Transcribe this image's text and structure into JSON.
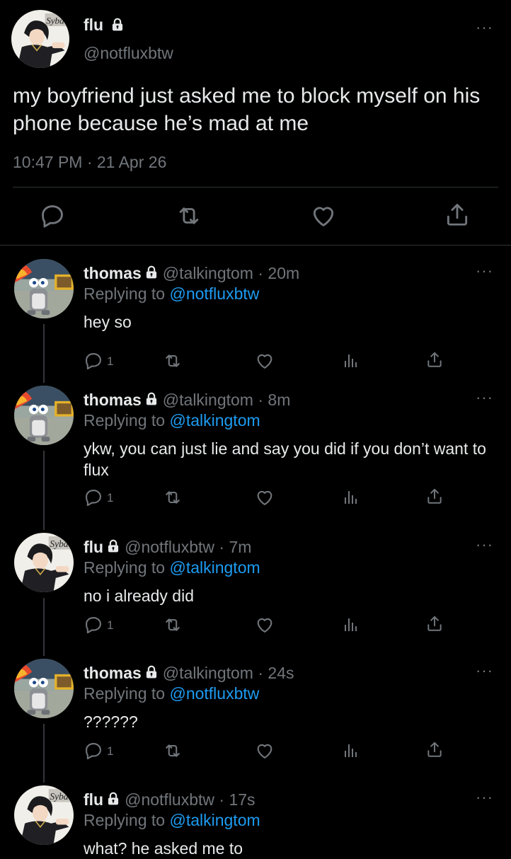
{
  "main_tweet": {
    "name": "flu",
    "handle": "@notfluxbtw",
    "text": "my boyfriend just asked me to block myself on his phone because he’s mad at me",
    "time": "10:47 PM · 21 Apr 26"
  },
  "replies": [
    {
      "name": "thomas",
      "handle": "@talkingtom",
      "age": "· 20m",
      "replying_prefix": "Replying to ",
      "replying_to": "@notfluxbtw",
      "text": "hey so",
      "reply_count": "1",
      "avatar": "tom"
    },
    {
      "name": "thomas",
      "handle": "@talkingtom",
      "age": "· 8m",
      "replying_prefix": "Replying to ",
      "replying_to": "@talkingtom",
      "text": "ykw, you can just lie and say you did if you don’t want to flux",
      "reply_count": "1",
      "avatar": "tom"
    },
    {
      "name": "flu",
      "handle": "@notfluxbtw",
      "age": "· 7m",
      "replying_prefix": "Replying to ",
      "replying_to": "@talkingtom",
      "text": "no i already did",
      "reply_count": "1",
      "avatar": "flu"
    },
    {
      "name": "thomas",
      "handle": "@talkingtom",
      "age": "· 24s",
      "replying_prefix": "Replying to ",
      "replying_to": "@notfluxbtw",
      "text": "??????",
      "reply_count": "1",
      "avatar": "tom"
    },
    {
      "name": "flu",
      "handle": "@notfluxbtw",
      "age": "· 17s",
      "replying_prefix": "Replying to ",
      "replying_to": "@talkingtom",
      "text": "what? he asked me to",
      "reply_count": "",
      "avatar": "flu"
    }
  ],
  "icons": {
    "more": "more-icon",
    "reply": "reply-icon",
    "retweet": "retweet-icon",
    "like": "heart-icon",
    "views": "analytics-icon",
    "share": "share-icon",
    "lock": "lock-icon"
  },
  "colors": {
    "background": "#000000",
    "accent": "#1d9bf0",
    "secondary": "#71767b",
    "divider": "#2f3336"
  }
}
